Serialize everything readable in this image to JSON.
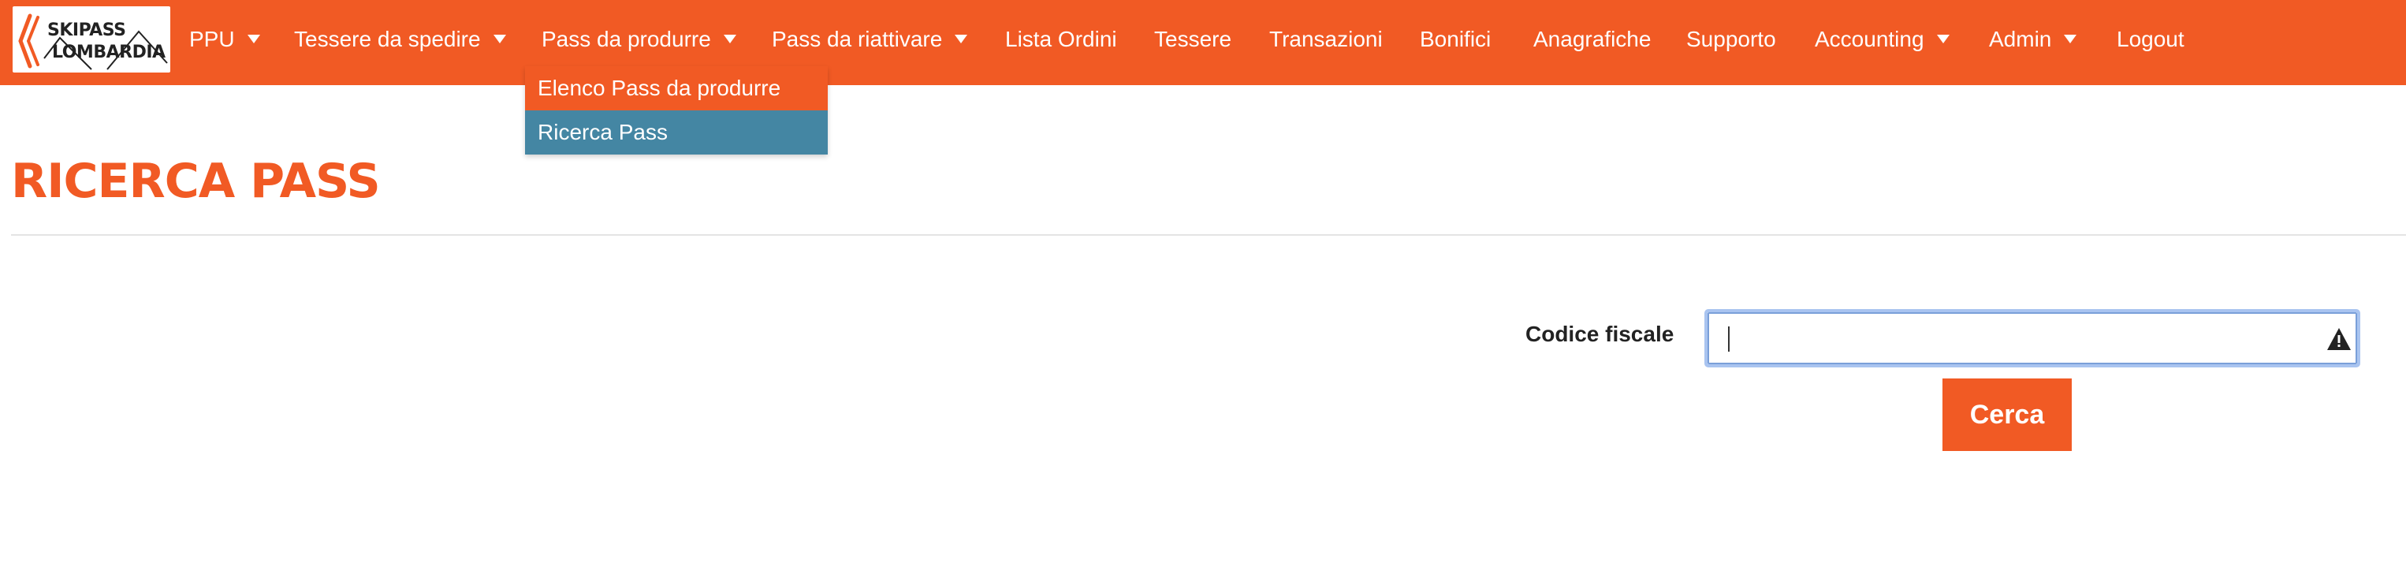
{
  "logo": {
    "line1": "SKIPASS",
    "line2": "LOMBARDIA",
    "icon": "skipass-lombardia-logo"
  },
  "nav": {
    "items": [
      {
        "label": "PPU",
        "dropdown": true
      },
      {
        "label": "Tessere da spedire",
        "dropdown": true
      },
      {
        "label": "Pass da produrre",
        "dropdown": true
      },
      {
        "label": "Pass da riattivare",
        "dropdown": true
      },
      {
        "label": "Lista Ordini",
        "dropdown": false
      },
      {
        "label": "Tessere",
        "dropdown": false
      },
      {
        "label": "Transazioni",
        "dropdown": false
      },
      {
        "label": "Bonifici",
        "dropdown": false
      },
      {
        "label": "Anagrafiche",
        "dropdown": false
      },
      {
        "label": "Supporto",
        "dropdown": false
      },
      {
        "label": "Accounting",
        "dropdown": true
      },
      {
        "label": "Admin",
        "dropdown": true
      },
      {
        "label": "Logout",
        "dropdown": false
      }
    ]
  },
  "dropdown": {
    "items": [
      {
        "label": "Elenco Pass da produrre"
      },
      {
        "label": "Ricerca Pass"
      }
    ]
  },
  "page": {
    "title": "RICERCA PASS"
  },
  "form": {
    "codice_fiscale_label": "Codice fiscale",
    "codice_fiscale_value": "",
    "warning_icon": "warning-triangle-icon",
    "submit_label": "Cerca"
  },
  "colors": {
    "brand": "#f15a24",
    "dropdown_active": "#4486a3",
    "input_focus": "#a9c4f0"
  }
}
